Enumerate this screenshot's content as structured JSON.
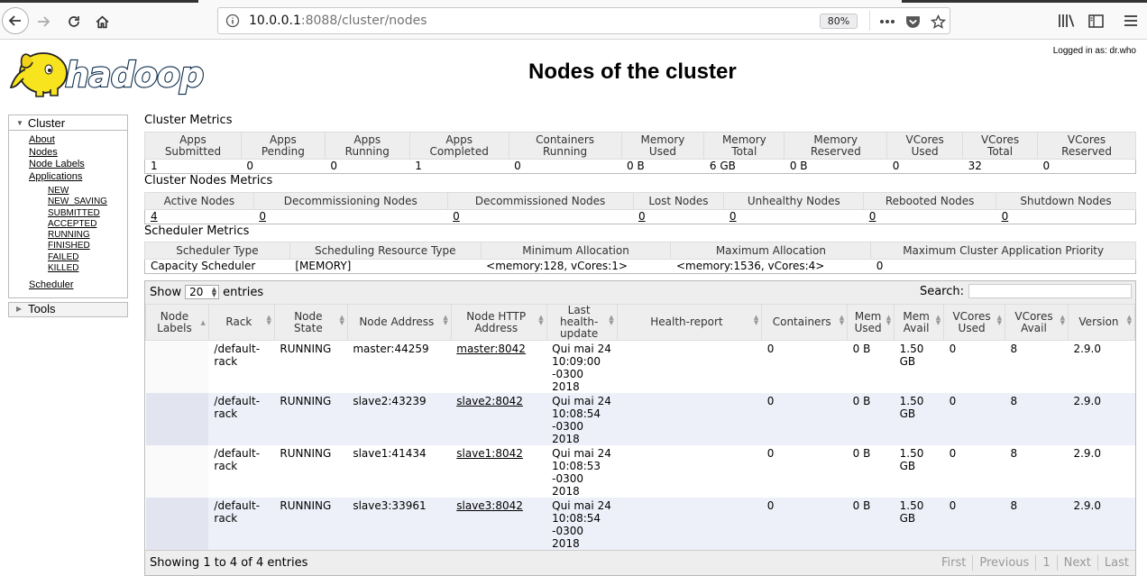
{
  "browser": {
    "url_host": "10.0.0.1",
    "url_rest": ":8088/cluster/nodes",
    "zoom": "80%"
  },
  "header": {
    "logged_in": "Logged in as: dr.who",
    "title": "Nodes of the cluster",
    "logo_text": "hadoop"
  },
  "sidebar": {
    "cluster_label": "Cluster",
    "about": "About",
    "nodes": "Nodes",
    "node_labels": "Node Labels",
    "applications": "Applications",
    "app_states": [
      "NEW",
      "NEW_SAVING",
      "SUBMITTED",
      "ACCEPTED",
      "RUNNING",
      "FINISHED",
      "FAILED",
      "KILLED"
    ],
    "scheduler": "Scheduler",
    "tools_label": "Tools"
  },
  "cluster_metrics": {
    "title": "Cluster Metrics",
    "headers": [
      [
        "Apps",
        "Submitted"
      ],
      [
        "Apps",
        "Pending"
      ],
      [
        "Apps",
        "Running"
      ],
      [
        "Apps",
        "Completed"
      ],
      [
        "Containers",
        "Running"
      ],
      [
        "Memory",
        "Used"
      ],
      [
        "Memory",
        "Total"
      ],
      [
        "Memory",
        "Reserved"
      ],
      [
        "VCores",
        "Used"
      ],
      [
        "VCores",
        "Total"
      ],
      [
        "VCores",
        "Reserved"
      ]
    ],
    "values": [
      "1",
      "0",
      "0",
      "1",
      "0",
      "0 B",
      "6 GB",
      "0 B",
      "0",
      "32",
      "0"
    ]
  },
  "node_metrics": {
    "title": "Cluster Nodes Metrics",
    "headers": [
      "Active Nodes",
      "Decommissioning Nodes",
      "Decommissioned Nodes",
      "Lost Nodes",
      "Unhealthy Nodes",
      "Rebooted Nodes",
      "Shutdown Nodes"
    ],
    "values": [
      "4",
      "0",
      "0",
      "0",
      "0",
      "0",
      "0"
    ]
  },
  "scheduler_metrics": {
    "title": "Scheduler Metrics",
    "headers": [
      "Scheduler Type",
      "Scheduling Resource Type",
      "Minimum Allocation",
      "Maximum Allocation",
      "Maximum Cluster Application Priority"
    ],
    "values": [
      "Capacity Scheduler",
      "[MEMORY]",
      "<memory:128, vCores:1>",
      "<memory:1536, vCores:4>",
      "0"
    ]
  },
  "nodes_table": {
    "show_label": "Show",
    "page_size": "20",
    "entries_label": "entries",
    "search_label": "Search:",
    "search_value": "",
    "headers": [
      [
        "Node",
        "Labels"
      ],
      [
        "Rack"
      ],
      [
        "Node State"
      ],
      [
        "Node Address"
      ],
      [
        "Node HTTP",
        "Address"
      ],
      [
        "Last health-",
        "update"
      ],
      [
        "Health-report"
      ],
      [
        "Containers"
      ],
      [
        "Mem",
        "Used"
      ],
      [
        "Mem",
        "Avail"
      ],
      [
        "VCores",
        "Used"
      ],
      [
        "VCores",
        "Avail"
      ],
      [
        "Version"
      ]
    ],
    "rows": [
      {
        "labels": "",
        "rack": [
          "/default-",
          "rack"
        ],
        "state": "RUNNING",
        "address": "master:44259",
        "http": "master:8042",
        "health_update": [
          "Qui mai 24",
          "10:09:00",
          "-0300 2018"
        ],
        "report": "",
        "containers": "0",
        "mem_used": "0 B",
        "mem_avail": [
          "1.50",
          "GB"
        ],
        "vcores_used": "0",
        "vcores_avail": "8",
        "version": "2.9.0"
      },
      {
        "labels": "",
        "rack": [
          "/default-",
          "rack"
        ],
        "state": "RUNNING",
        "address": "slave2:43239",
        "http": "slave2:8042",
        "health_update": [
          "Qui mai 24",
          "10:08:54",
          "-0300 2018"
        ],
        "report": "",
        "containers": "0",
        "mem_used": "0 B",
        "mem_avail": [
          "1.50",
          "GB"
        ],
        "vcores_used": "0",
        "vcores_avail": "8",
        "version": "2.9.0"
      },
      {
        "labels": "",
        "rack": [
          "/default-",
          "rack"
        ],
        "state": "RUNNING",
        "address": "slave1:41434",
        "http": "slave1:8042",
        "health_update": [
          "Qui mai 24",
          "10:08:53",
          "-0300 2018"
        ],
        "report": "",
        "containers": "0",
        "mem_used": "0 B",
        "mem_avail": [
          "1.50",
          "GB"
        ],
        "vcores_used": "0",
        "vcores_avail": "8",
        "version": "2.9.0"
      },
      {
        "labels": "",
        "rack": [
          "/default-",
          "rack"
        ],
        "state": "RUNNING",
        "address": "slave3:33961",
        "http": "slave3:8042",
        "health_update": [
          "Qui mai 24",
          "10:08:54",
          "-0300 2018"
        ],
        "report": "",
        "containers": "0",
        "mem_used": "0 B",
        "mem_avail": [
          "1.50",
          "GB"
        ],
        "vcores_used": "0",
        "vcores_avail": "8",
        "version": "2.9.0"
      }
    ],
    "info": "Showing 1 to 4 of 4 entries",
    "pagination": [
      "First",
      "Previous",
      "1",
      "Next",
      "Last"
    ]
  }
}
